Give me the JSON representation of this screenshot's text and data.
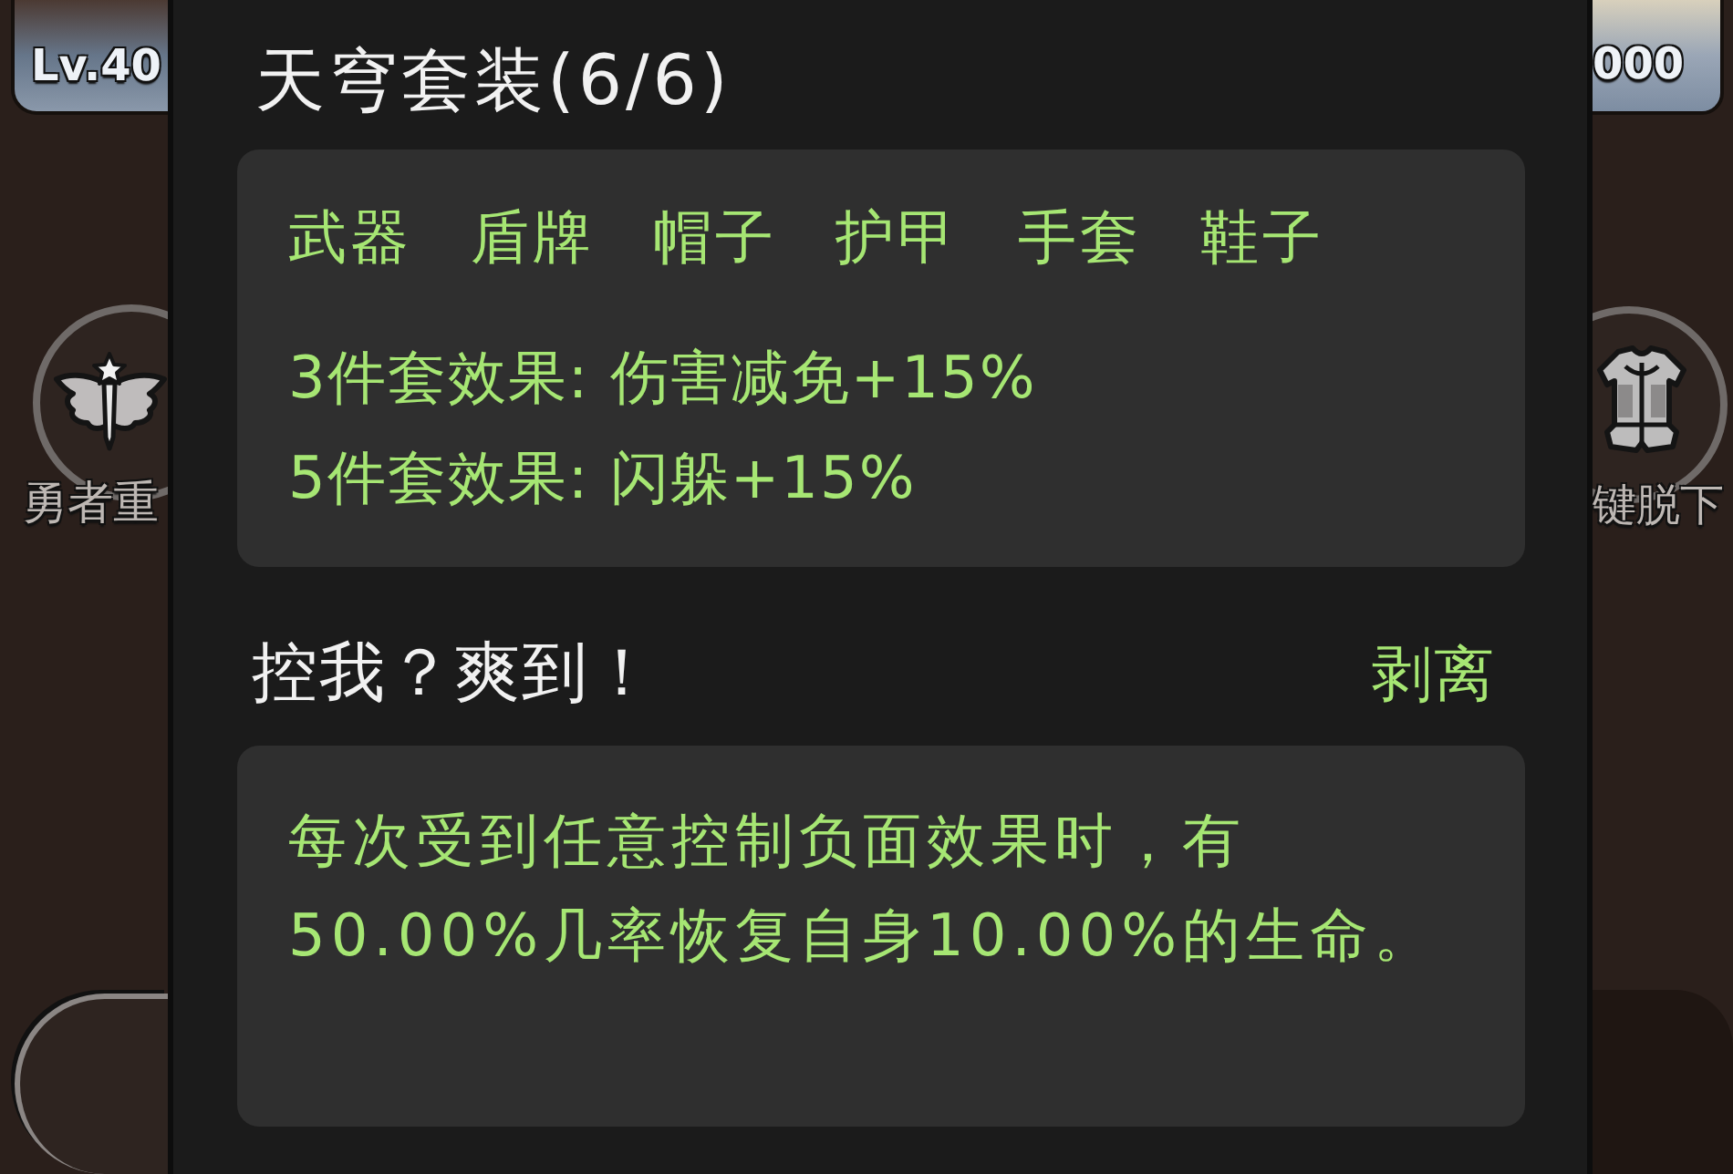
{
  "side_left": {
    "level_badge": "Lv.40",
    "button_label": "勇者重"
  },
  "set_panel": {
    "title": "天穹套装(6/6)",
    "pieces": [
      "武器",
      "盾牌",
      "帽子",
      "护甲",
      "手套",
      "鞋子"
    ],
    "bonuses": [
      "3件套效果: 伤害减免+15%",
      "5件套效果: 闪躲+15%"
    ]
  },
  "skill_panel": {
    "title": "控我？爽到！",
    "action": "剥离",
    "description": "每次受到任意控制负面效果时，有50.00%几率恢复自身10.00%的生命。"
  },
  "side_right": {
    "badge_value": "000",
    "button_label": "键脱下"
  }
}
